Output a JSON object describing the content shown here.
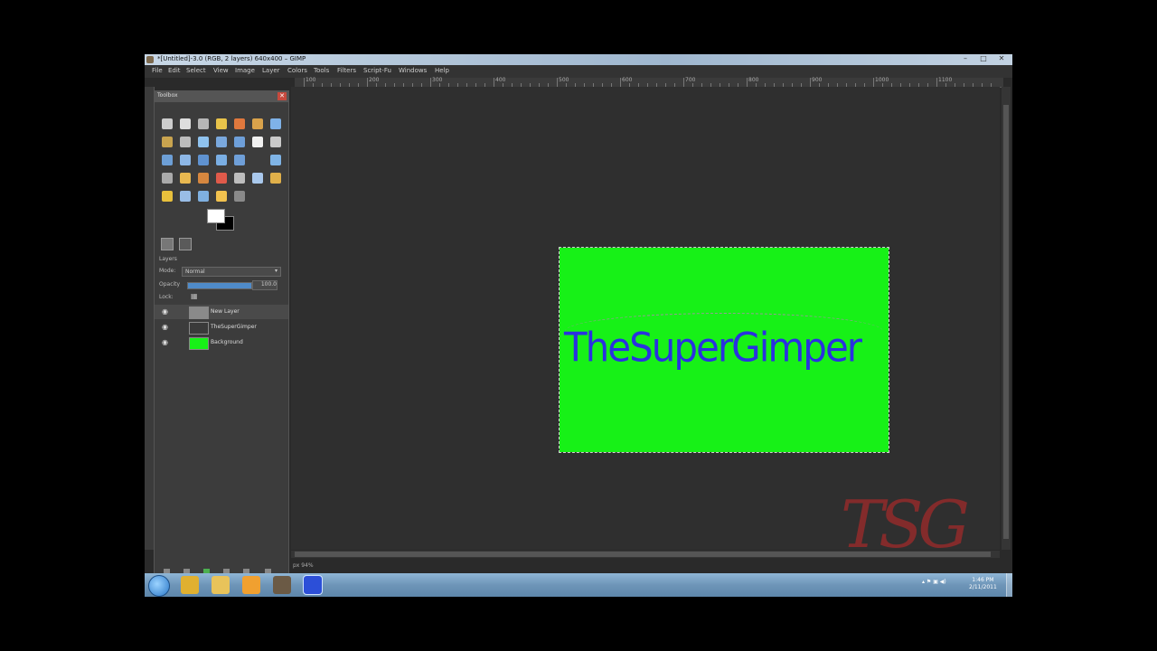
{
  "window": {
    "title": "*[Untitled]-3.0 (RGB, 2 layers) 640x400 – GIMP",
    "controls": [
      "–",
      "□",
      "✕"
    ]
  },
  "menu": [
    "File",
    "Edit",
    "Select",
    "View",
    "Image",
    "Layer",
    "Colors",
    "Tools",
    "Filters",
    "Script-Fu",
    "Windows",
    "Help"
  ],
  "ruler": {
    "labels": [
      "100",
      "200",
      "300",
      "400",
      "500",
      "600",
      "700",
      "800",
      "900",
      "1000",
      "1100"
    ]
  },
  "toolbox": {
    "title": "Toolbox",
    "close": "✕",
    "tool_colors": [
      "#cccccc",
      "#dddddd",
      "#b7b7b7",
      "#e8c34a",
      "#e0783d",
      "#d9a24b",
      "#7fb2e8",
      "#c9a44f",
      "#bcbcbc",
      "#8fc2ee",
      "#7aa8dd",
      "#6e9fd9",
      "#f0f0f0",
      "#c9c9c9",
      "#6d9fd6",
      "#8db7e6",
      "#5f92d0",
      "#7aaee3",
      "#6f9fd8",
      "#3c3c3c",
      "#7fb4e6",
      "#aaaaaa",
      "#e8b850",
      "#d6873f",
      "#e05a4a",
      "#bdbdbd",
      "#a9c8ec",
      "#e0b04a",
      "#e8c03c",
      "#99bde6",
      "#7fb0e0",
      "#f2c24e",
      "#8a8a8a"
    ]
  },
  "layers_dock": {
    "panel_label": "Layers",
    "mode_label": "Mode:",
    "mode_value": "Normal",
    "opacity_label": "Opacity",
    "opacity_value": "100.0",
    "opacity_fraction": 1.0,
    "lock_label": "Lock:",
    "layers": [
      {
        "name": "New Layer",
        "thumb": "#8a8a8a",
        "active": true
      },
      {
        "name": "TheSuperGimper",
        "thumb": "#3a3a3a",
        "active": false
      },
      {
        "name": "Background",
        "thumb": "#17f117",
        "active": false
      }
    ]
  },
  "canvas": {
    "image_bg": "#17f117",
    "text": "TheSuperGimper",
    "text_color": "#2a31e0"
  },
  "status": {
    "text": "px 94%"
  },
  "watermark": "TSG",
  "taskbar": {
    "icons": [
      {
        "name": "chrome-icon",
        "color": "#e0b030"
      },
      {
        "name": "explorer-icon",
        "color": "#e8c35a"
      },
      {
        "name": "media-player-icon",
        "color": "#f0a030"
      },
      {
        "name": "gimp-icon",
        "color": "#6b5a45"
      },
      {
        "name": "active-window-icon",
        "color": "#2c4fd8"
      }
    ],
    "tray": "▴ ⚑ ▣ ◀)",
    "time": "1:46 PM",
    "date": "2/11/2011"
  }
}
